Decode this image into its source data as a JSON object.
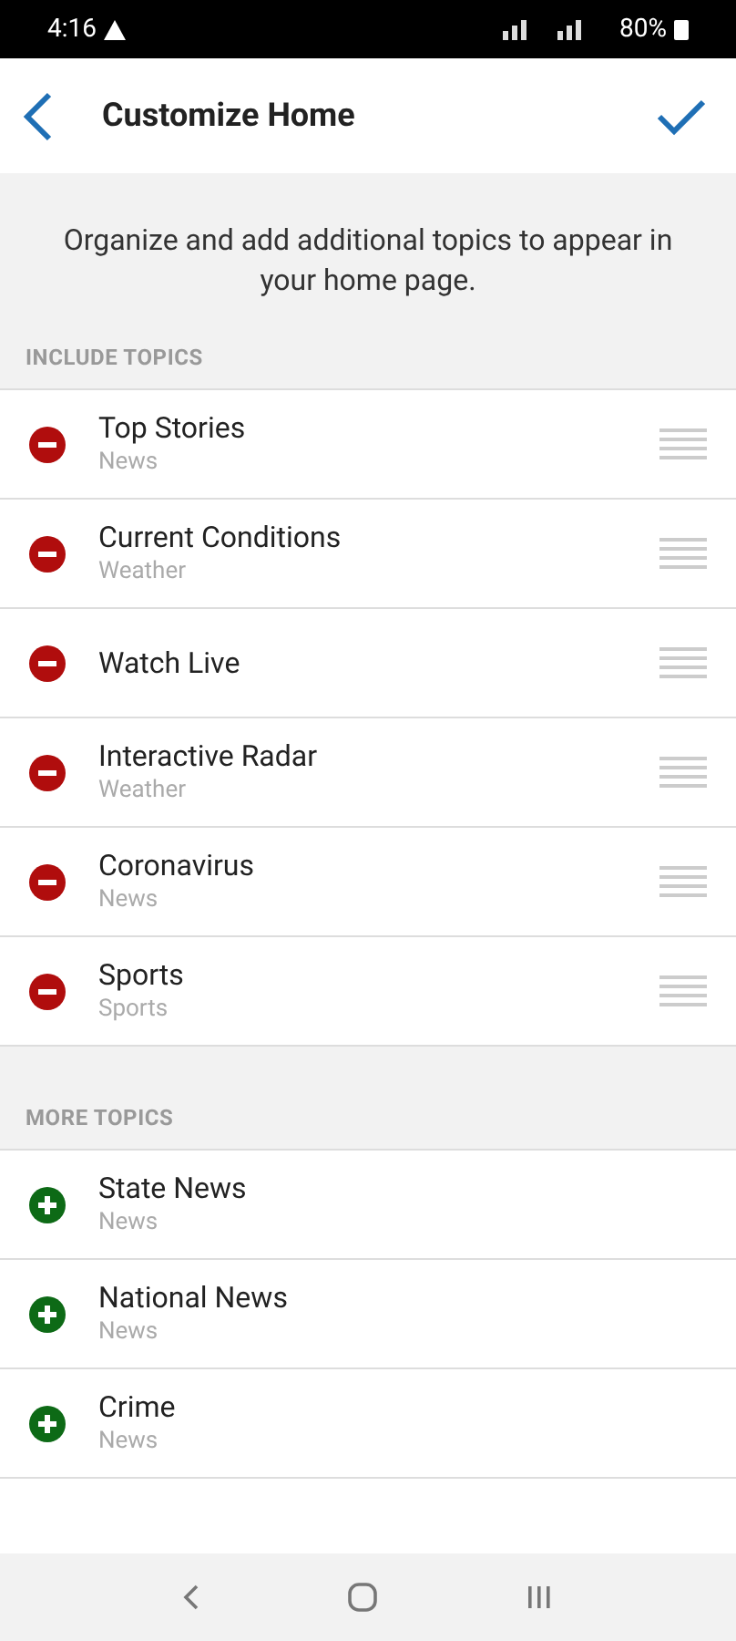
{
  "status_bar": {
    "time": "4:16",
    "battery": "80%"
  },
  "header": {
    "title": "Customize Home"
  },
  "description": "Organize and add additional topics to appear in your home page.",
  "sections": [
    {
      "title": "INCLUDE TOPICS",
      "kind": "remove",
      "items": [
        {
          "title": "Top Stories",
          "subtitle": "News"
        },
        {
          "title": "Current Conditions",
          "subtitle": "Weather"
        },
        {
          "title": "Watch Live"
        },
        {
          "title": "Interactive Radar",
          "subtitle": "Weather"
        },
        {
          "title": "Coronavirus",
          "subtitle": "News"
        },
        {
          "title": "Sports",
          "subtitle": "Sports"
        }
      ]
    },
    {
      "title": "MORE TOPICS",
      "kind": "add",
      "items": [
        {
          "title": "State News",
          "subtitle": "News"
        },
        {
          "title": "National News",
          "subtitle": "News"
        },
        {
          "title": "Crime",
          "subtitle": "News"
        }
      ]
    }
  ]
}
